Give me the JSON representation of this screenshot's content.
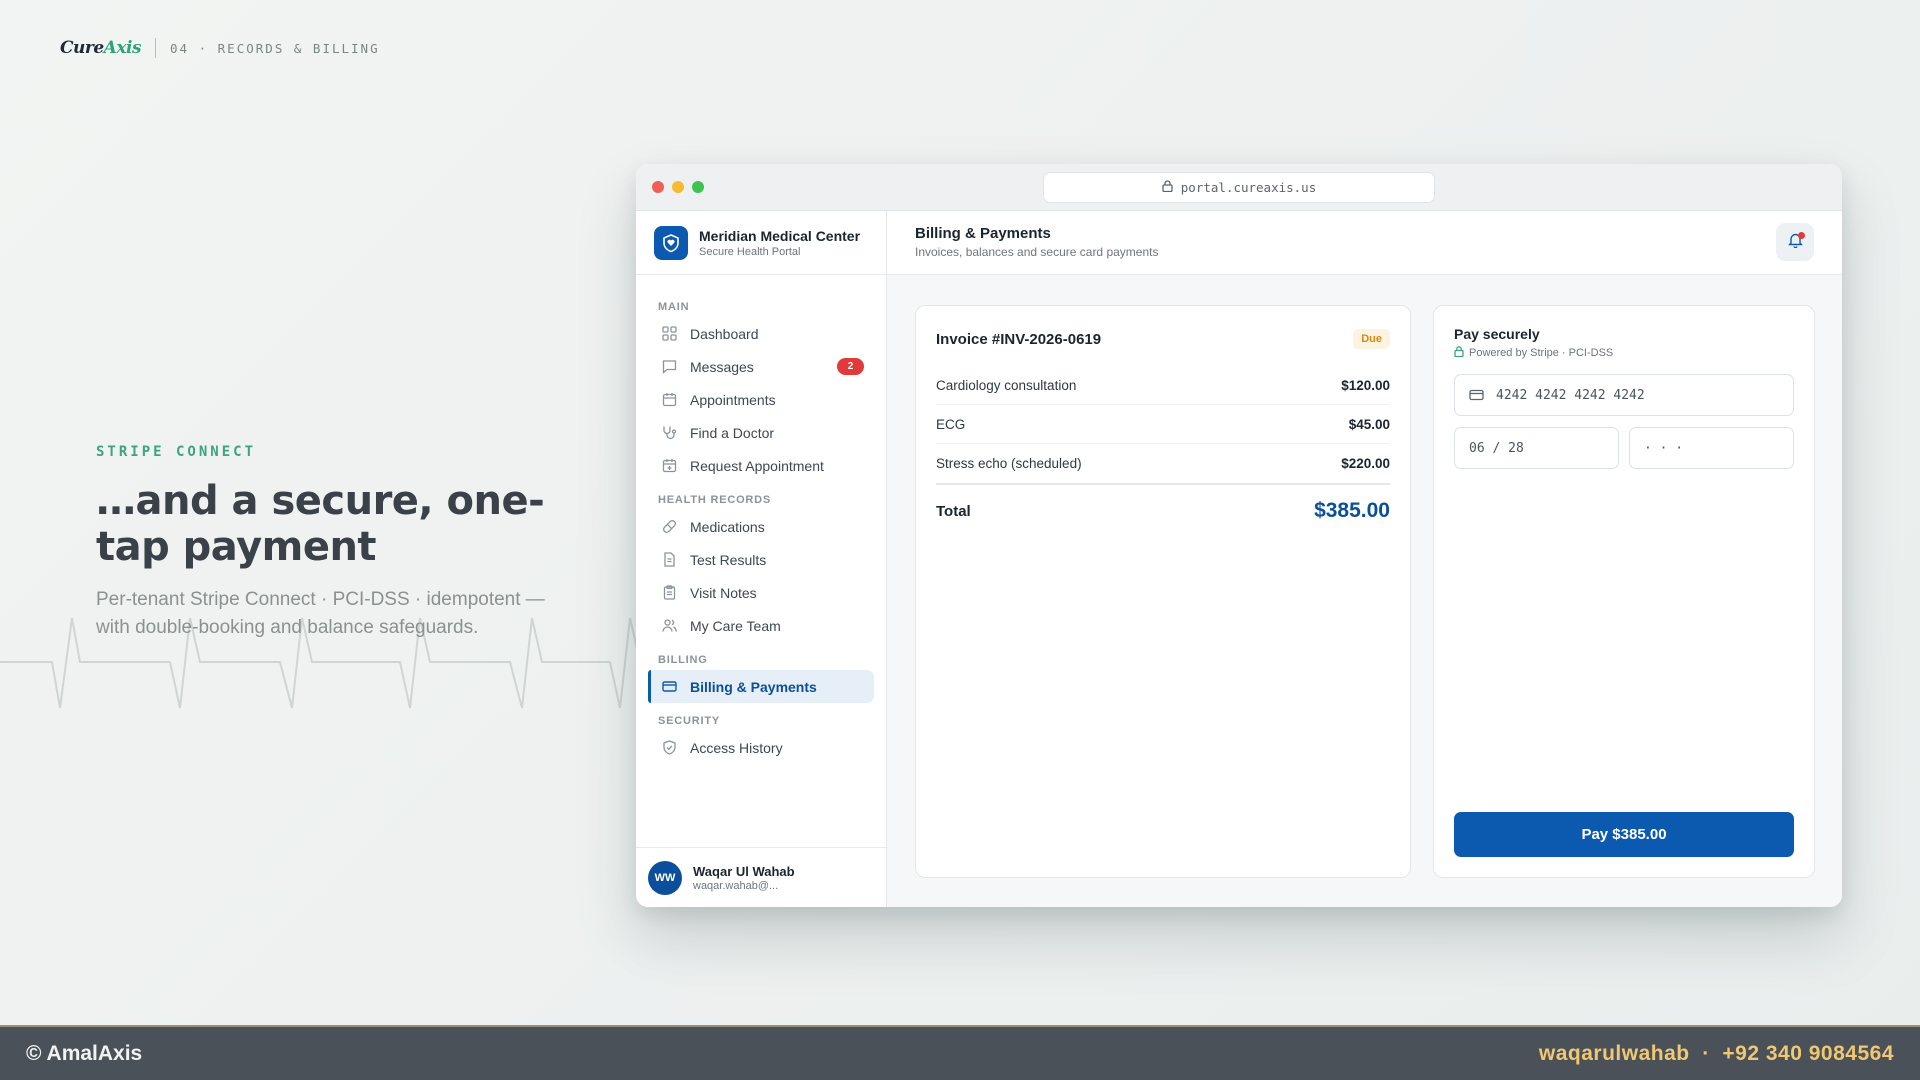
{
  "brand": {
    "logo_main": "Cure",
    "logo_accent": "Axis",
    "crumb": "04 · RECORDS & BILLING"
  },
  "hero": {
    "eyebrow": "STRIPE CONNECT",
    "title": "…and a secure, one-tap payment",
    "subtitle": "Per-tenant Stripe Connect · PCI-DSS · idempotent — with double-booking and balance safeguards."
  },
  "browser": {
    "url": "portal.cureaxis.us"
  },
  "org": {
    "name": "Meridian Medical Center",
    "subtitle": "Secure Health Portal"
  },
  "nav": {
    "main_label": "MAIN",
    "dashboard": "Dashboard",
    "messages": "Messages",
    "messages_badge": "2",
    "appointments": "Appointments",
    "find_doctor": "Find a Doctor",
    "request_appointment": "Request Appointment",
    "health_label": "HEALTH RECORDS",
    "medications": "Medications",
    "test_results": "Test Results",
    "visit_notes": "Visit Notes",
    "care_team": "My Care Team",
    "billing_label": "BILLING",
    "billing": "Billing & Payments",
    "security_label": "SECURITY",
    "access_history": "Access History"
  },
  "user": {
    "initials": "WW",
    "name": "Waqar Ul Wahab",
    "email": "waqar.wahab@..."
  },
  "header": {
    "title": "Billing & Payments",
    "subtitle": "Invoices, balances and secure card payments"
  },
  "invoice": {
    "title": "Invoice #INV-2026-0619",
    "status": "Due",
    "lines": [
      {
        "label": "Cardiology consultation",
        "amount": "$120.00"
      },
      {
        "label": "ECG",
        "amount": "$45.00"
      },
      {
        "label": "Stress echo (scheduled)",
        "amount": "$220.00"
      }
    ],
    "total_label": "Total",
    "total": "$385.00"
  },
  "payment": {
    "title": "Pay securely",
    "subtitle": "Powered by Stripe · PCI-DSS",
    "card_number": "4242 4242 4242 4242",
    "expiry": "06 / 28",
    "cvc": "· · ·",
    "button": "Pay $385.00"
  },
  "footer": {
    "left": "© AmalAxis",
    "right": "waqarulwahab  ·  +92 340 9084564"
  },
  "colors": {
    "primary": "#0b5ab0",
    "accent": "#3aa57f",
    "due": "#d48a13",
    "badge": "#e03a3a"
  }
}
